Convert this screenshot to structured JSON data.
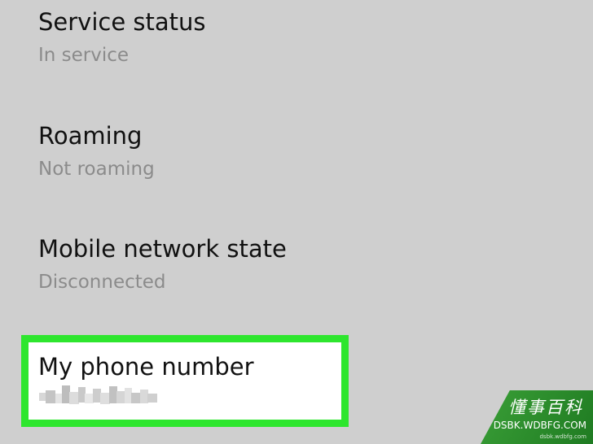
{
  "items": [
    {
      "title": "Service status",
      "subtitle": "In service"
    },
    {
      "title": "Roaming",
      "subtitle": "Not roaming"
    },
    {
      "title": "Mobile network state",
      "subtitle": "Disconnected"
    }
  ],
  "phone": {
    "title": "My phone number"
  },
  "colors": {
    "background": "#cfcfcf",
    "highlight_border": "#2ee62e",
    "subtitle": "#8b8b8b"
  },
  "watermark": {
    "top": "懂事百科",
    "url": "DSBK.WDBFG.COM",
    "small": "dsbk.wdbfg.com"
  }
}
